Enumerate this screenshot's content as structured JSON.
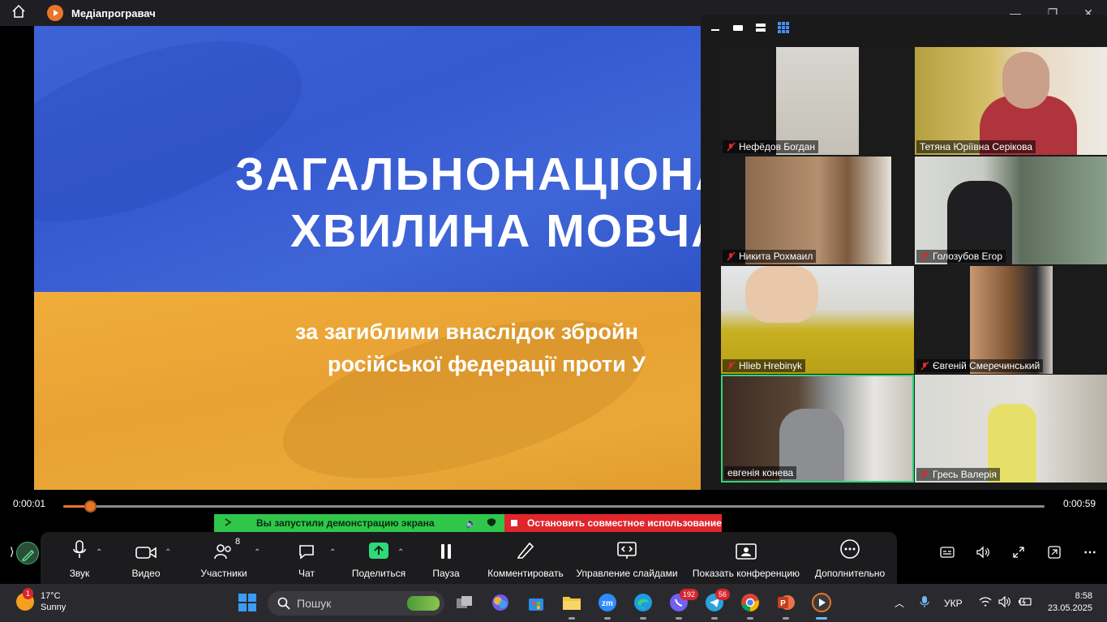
{
  "window": {
    "title": "Медіапрогравач",
    "home_icon": "home-icon",
    "app_icon": "media-player-icon",
    "controls": [
      "minimize-icon",
      "maximize-icon",
      "close-icon"
    ]
  },
  "video": {
    "title_line1": "ЗАГАЛЬНОНАЦІОНА",
    "title_line2": "ХВИЛИНА МОВЧА",
    "subtitle_line1": "за загиблими внаслідок збройн",
    "subtitle_line2": "російської федерації проти У",
    "colors": {
      "blue": "#3559d0",
      "yellow": "#e8a234"
    }
  },
  "gallery": {
    "view_icons": [
      "minimize-icon",
      "speaker-view-icon",
      "strip-view-icon",
      "grid-view-icon"
    ],
    "participants": [
      {
        "name": "Нефёдов Богдан",
        "muted": true,
        "active": false
      },
      {
        "name": "Тетяна Юріївна Серікова",
        "muted": false,
        "active": false
      },
      {
        "name": "Никита Рохмаил",
        "muted": true,
        "active": false
      },
      {
        "name": "Голозубов Егор",
        "muted": true,
        "active": false
      },
      {
        "name": "Hlieb Hrebinyk",
        "muted": true,
        "active": false
      },
      {
        "name": "Євгеній Смеречинський",
        "muted": true,
        "active": false
      },
      {
        "name": "евгенія  конева",
        "muted": false,
        "active": true
      },
      {
        "name": "Гресь Валерія",
        "muted": true,
        "active": false
      }
    ]
  },
  "progress": {
    "current": "0:00:01",
    "total": "0:00:59",
    "fraction": 0.027,
    "accent": "#e8752a"
  },
  "share_banner": {
    "status": "Вы запустили демонстрацию экрана",
    "stop": "Остановить совместное использование"
  },
  "toolbar": {
    "audio": "Звук",
    "video": "Видео",
    "participants": "Участники",
    "participants_count": "8",
    "chat": "Чат",
    "share": "Поделиться",
    "pause": "Пауза",
    "annotate": "Комментировать",
    "slides": "Управление слайдами",
    "show_meeting": "Показать конференцию",
    "more": "Дополнительно"
  },
  "media_right_icons": [
    "subtitles-icon",
    "volume-icon",
    "fullscreen-icon",
    "miniplayer-icon",
    "more-icon"
  ],
  "taskbar": {
    "temp": "17°C",
    "condition": "Sunny",
    "weather_badge": "1",
    "search_placeholder": "Пошук",
    "viber_badge": "192",
    "telegram_badge": "56",
    "language": "УКР",
    "time": "8:58",
    "date": "23.05.2025"
  }
}
